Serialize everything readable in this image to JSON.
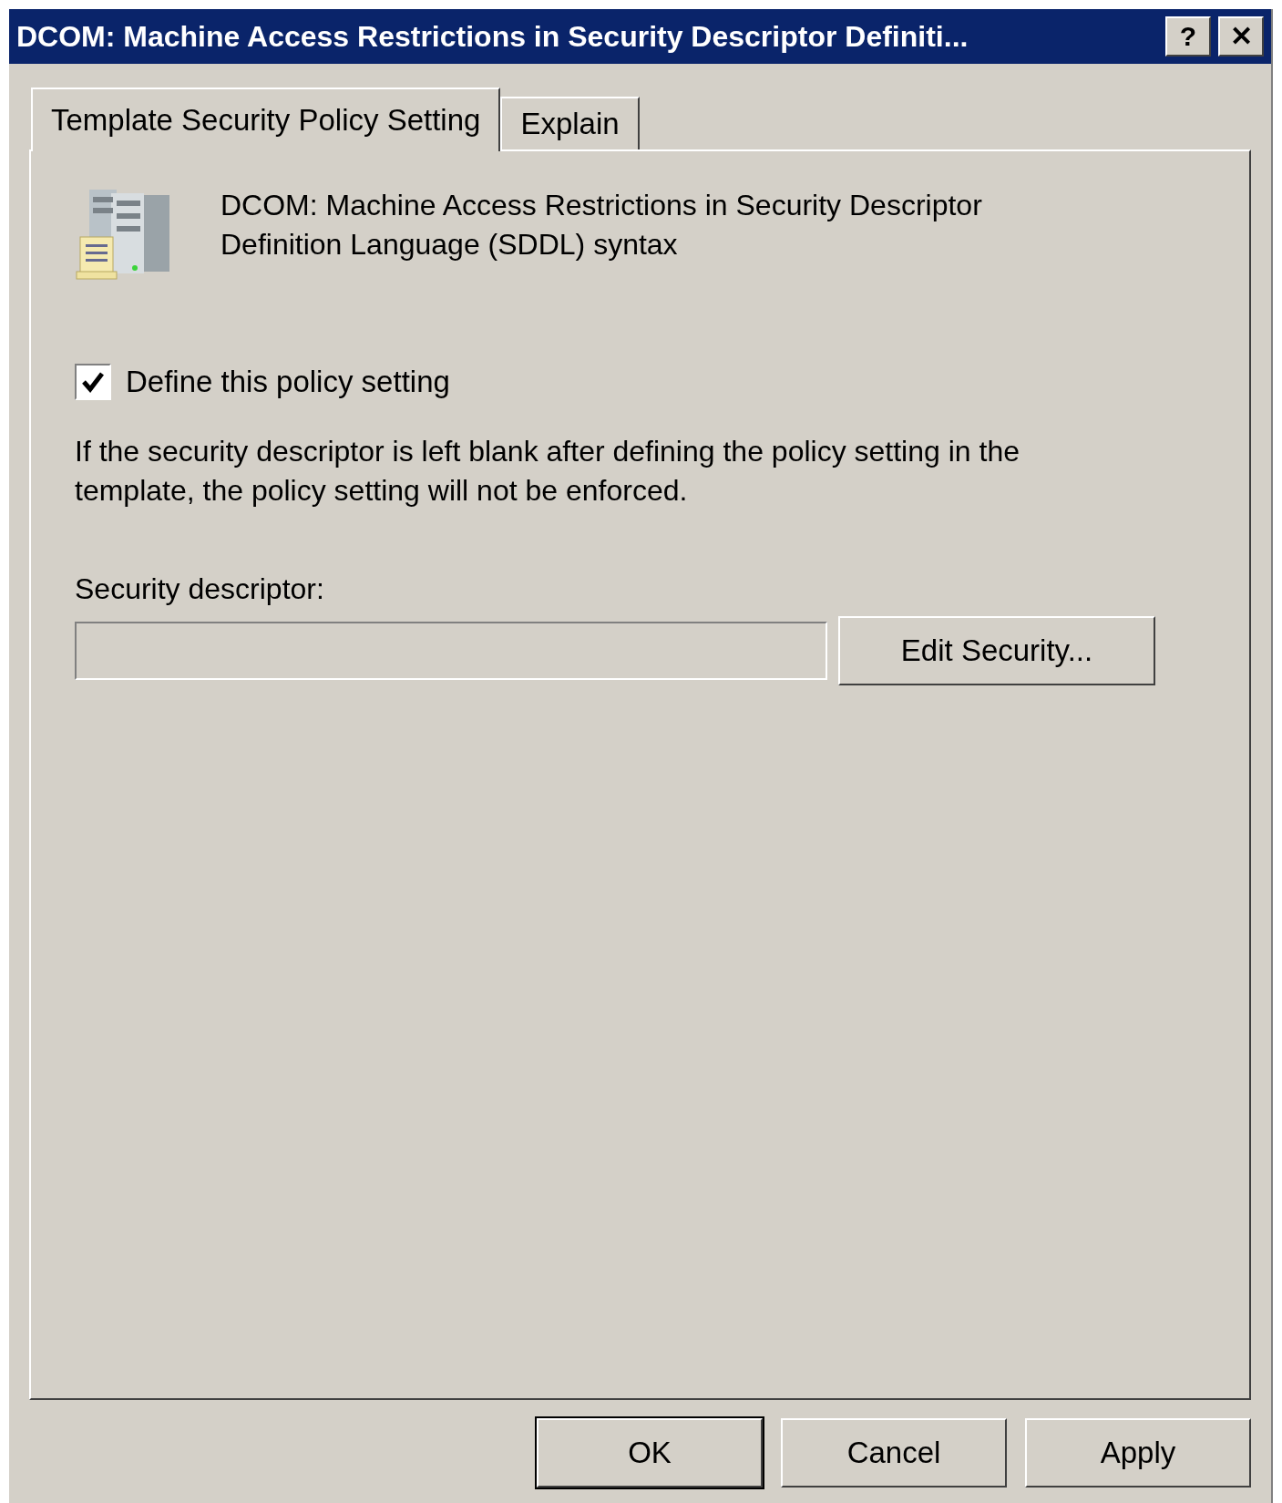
{
  "window": {
    "title": "DCOM: Machine Access Restrictions in Security Descriptor Definiti...",
    "title_buttons": [
      "?",
      "✕"
    ]
  },
  "tabs": [
    {
      "label": "Template Security Policy Setting",
      "selected": true
    },
    {
      "label": "Explain",
      "selected": false
    }
  ],
  "policy": {
    "title": "DCOM: Machine Access Restrictions in Security Descriptor Definition Language (SDDL) syntax"
  },
  "define_checkbox": {
    "label": "Define this policy setting",
    "checked": true
  },
  "note": "If the security descriptor is left blank after defining the policy setting in the template, the policy setting will not be enforced.",
  "descriptor": {
    "label": "Security descriptor:",
    "button": "Edit Security..."
  },
  "buttons": [
    {
      "label": "OK",
      "default": true
    },
    {
      "label": "Cancel",
      "default": false
    },
    {
      "label": "Apply",
      "default": false
    }
  ]
}
